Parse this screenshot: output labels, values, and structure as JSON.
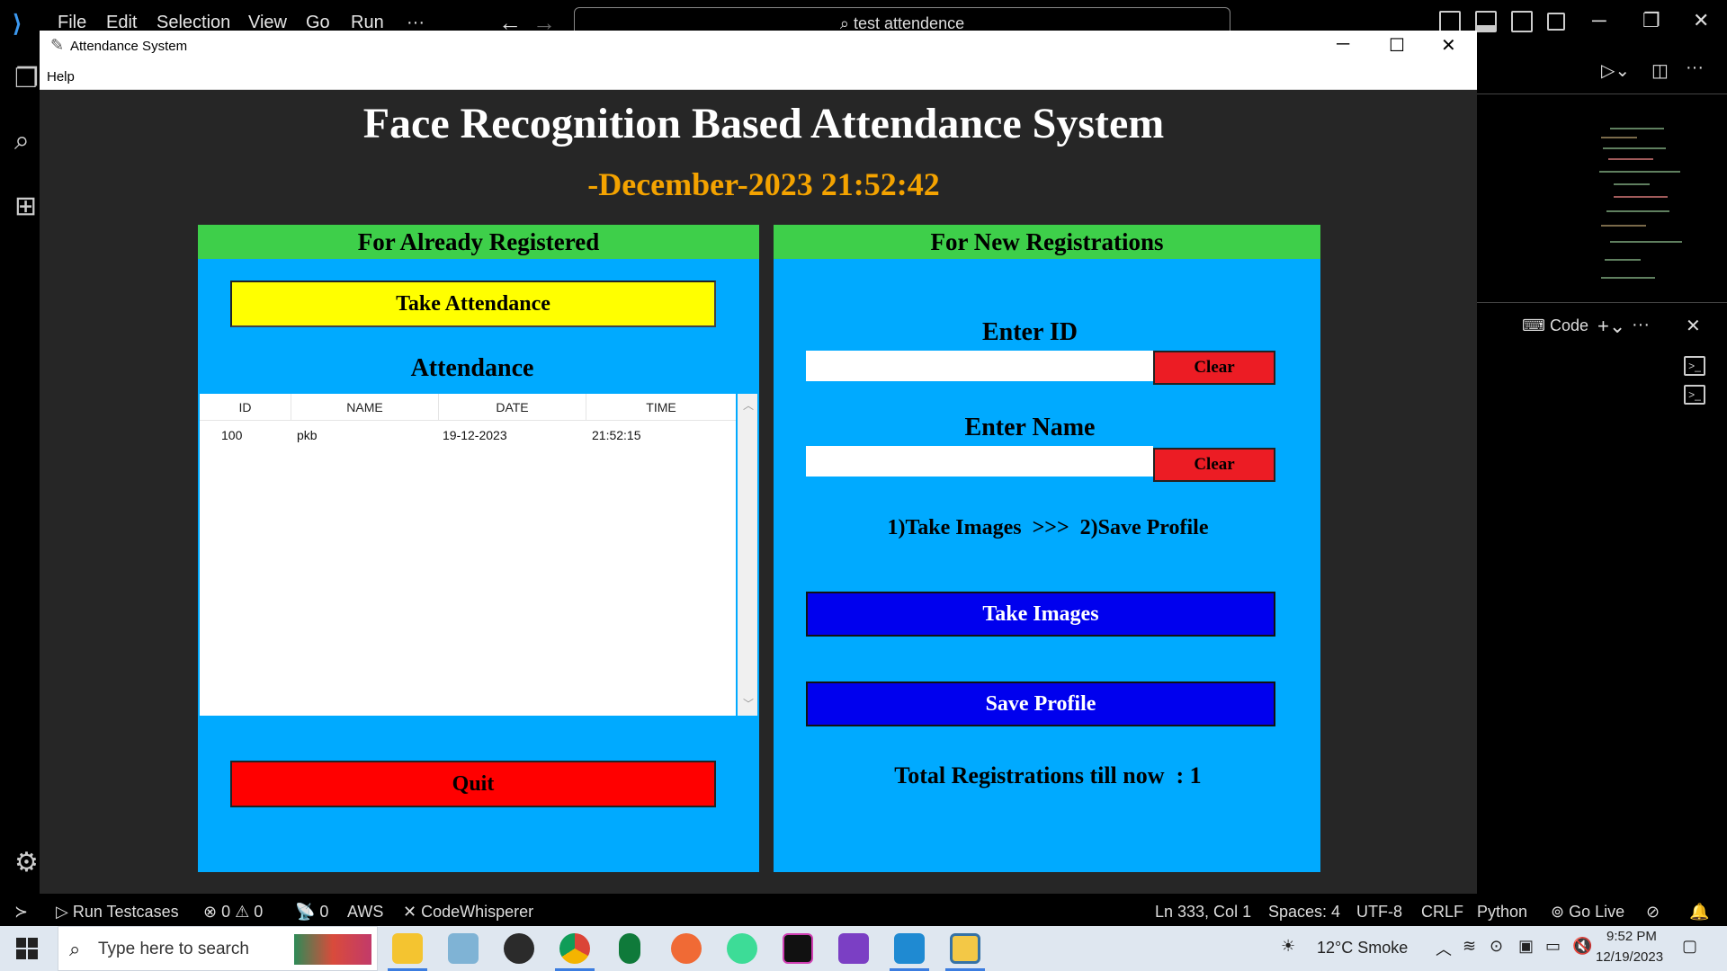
{
  "vscode": {
    "menu": [
      "File",
      "Edit",
      "Selection",
      "View",
      "Go",
      "Run"
    ],
    "menu_more": "···",
    "search_text": "test attendence",
    "terminal_label": "Code"
  },
  "tk": {
    "window_title": "Attendance System",
    "menu_help": "Help",
    "heading": "Face Recognition Based Attendance System",
    "datetime": "-December-2023 21:52:42"
  },
  "left_frame": {
    "header": "For Already Registered",
    "take_attendance_label": "Take Attendance",
    "attendance_label": "Attendance",
    "columns": [
      "ID",
      "NAME",
      "DATE",
      "TIME"
    ],
    "rows": [
      {
        "id": "100",
        "name": "pkb",
        "date": "19-12-2023",
        "time": "21:52:15"
      }
    ],
    "quit_label": "Quit"
  },
  "right_frame": {
    "header": "For New Registrations",
    "enter_id_label": "Enter ID",
    "enter_name_label": "Enter Name",
    "id_value": "",
    "name_value": "",
    "clear_label": "Clear",
    "steps_text": "1)Take Images  >>>  2)Save Profile",
    "take_images_label": "Take Images",
    "save_profile_label": "Save Profile",
    "total_text": "Total Registrations till now  : 1"
  },
  "status_bar": {
    "run_testcases": "Run Testcases",
    "errors": "0",
    "warnings": "0",
    "ports": "0",
    "aws": "AWS",
    "codewhisperer": "CodeWhisperer",
    "position": "Ln 333, Col 1",
    "spaces": "Spaces: 4",
    "encoding": "UTF-8",
    "eol": "CRLF",
    "language": "Python",
    "go_live": "Go Live"
  },
  "taskbar": {
    "search_placeholder": "Type here to search",
    "weather": "12°C  Smoke",
    "time": "9:52 PM",
    "date": "12/19/2023"
  },
  "colors": {
    "frame_bg": "#00aaff",
    "frame_header": "#3ecf4a",
    "take_attendance": "#ffff00",
    "quit": "#ff0000",
    "clear": "#ec1c24",
    "primary_buttons": "#0000ee",
    "datetime": "#f4a300"
  }
}
